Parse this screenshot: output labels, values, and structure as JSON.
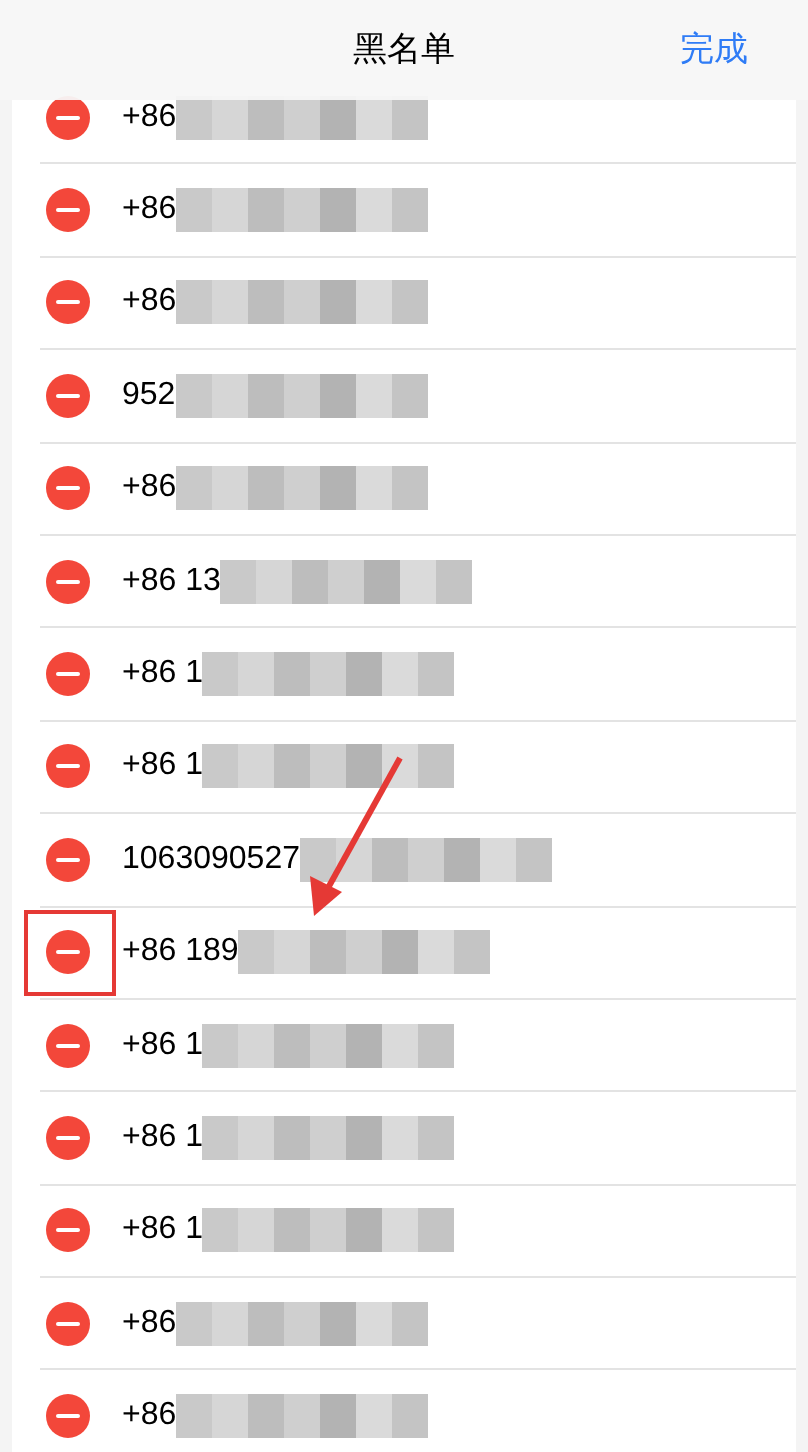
{
  "nav": {
    "title": "黑名单",
    "done": "完成"
  },
  "entries": [
    {
      "number": "+86",
      "annotated": false
    },
    {
      "number": "+86",
      "annotated": false
    },
    {
      "number": "+86",
      "annotated": false
    },
    {
      "number": "952",
      "annotated": false
    },
    {
      "number": "+86",
      "annotated": false
    },
    {
      "number": "+86 13",
      "annotated": false
    },
    {
      "number": "+86 1",
      "annotated": false
    },
    {
      "number": "+86 1",
      "annotated": false
    },
    {
      "number": "1063090527",
      "annotated": false
    },
    {
      "number": "+86 189",
      "annotated": true
    },
    {
      "number": "+86 1",
      "annotated": false
    },
    {
      "number": "+86 1",
      "annotated": false
    },
    {
      "number": "+86 1",
      "annotated": false
    },
    {
      "number": "+86",
      "annotated": false
    },
    {
      "number": "+86",
      "annotated": false
    }
  ]
}
